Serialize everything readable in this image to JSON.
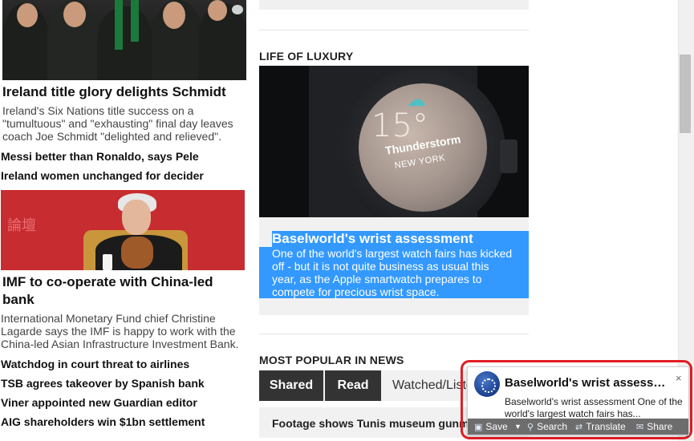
{
  "left_column": {
    "story1": {
      "headline": "Ireland title glory delights Schmidt",
      "standfirst": "Ireland's Six Nations title success on a \"tumultuous\" and \"exhausting\" final day leaves coach Joe Schmidt \"delighted and relieved\"."
    },
    "links1": [
      "Messi better than Ronaldo, says Pele",
      "Ireland women unchanged for decider"
    ],
    "story2": {
      "headline": "IMF to co-operate with China-led bank",
      "standfirst": "International Monetary Fund chief Christine Lagarde says the IMF is happy to work with the China-led Asian Infrastructure Investment Bank."
    },
    "links2": [
      "Watchdog in court threat to airlines",
      "TSB agrees takeover by Spanish bank",
      "Viner appointed new Guardian editor",
      "AIG shareholders win $1bn settlement"
    ]
  },
  "middle_column": {
    "life_section_title": "LIFE OF LUXURY",
    "watch_display": {
      "temperature": "15°",
      "condition": "Thunderstorm",
      "city": "NEW YORK"
    },
    "luxury_story": {
      "title": "Baselworld's wrist assessment",
      "text": "One of the world's largest watch fairs has kicked off - but it is not quite business as usual this year, as the Apple smartwatch prepares to compete for precious wrist space."
    },
    "popular_section_title": "MOST POPULAR IN NEWS",
    "tabs": [
      "Shared",
      "Read",
      "Watched/Listened"
    ],
    "popular_first_item": "Footage shows Tunis museum gunmen"
  },
  "notification": {
    "title": "Baselworld's wrist assessm...",
    "body": "Baselworld's wrist assessment  One of the world's largest watch fairs has...",
    "close_label": "×",
    "actions": {
      "save": "Save",
      "search": "Search",
      "translate": "Translate",
      "share": "Share"
    }
  },
  "colors": {
    "selection_blue": "#3399ff",
    "tab_dark": "#333333",
    "highlight_red": "#e21d24",
    "imf_photo_red": "#c72c30"
  }
}
